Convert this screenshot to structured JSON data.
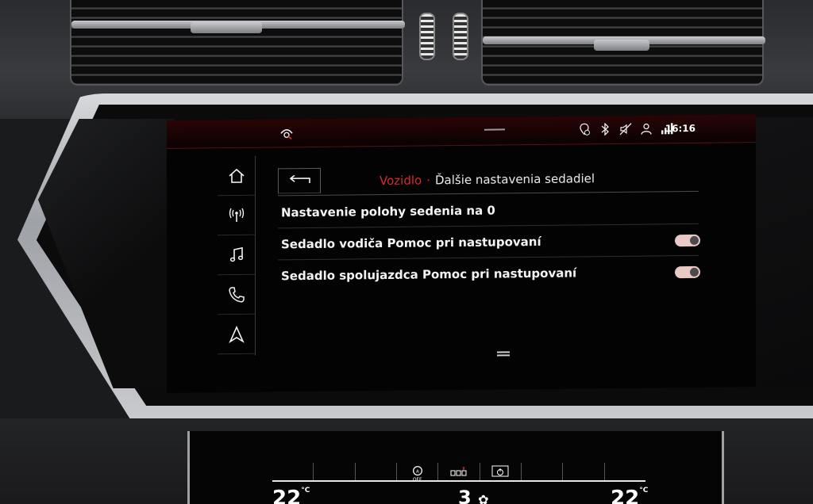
{
  "status_bar": {
    "time": "16:16",
    "icons": [
      "car-service-icon",
      "location-alert-icon",
      "bluetooth-icon",
      "mute-icon",
      "user-profile-icon",
      "signal-icon"
    ]
  },
  "nav": {
    "items": [
      {
        "name": "home-icon"
      },
      {
        "name": "radio-icon"
      },
      {
        "name": "music-icon"
      },
      {
        "name": "phone-icon"
      },
      {
        "name": "navigation-icon"
      }
    ]
  },
  "header": {
    "parent": "Vozidlo",
    "separator": "·",
    "title": "Ďalšie nastavenia sedadiel"
  },
  "settings": {
    "rows": [
      {
        "label": "Nastavenie polohy sedenia na 0",
        "has_toggle": false
      },
      {
        "label": "Sedadlo vodiča Pomoc pri nastupovaní",
        "has_toggle": true,
        "enabled": true
      },
      {
        "label": "Sedadlo spolujazdca Pomoc pri nastupovaní",
        "has_toggle": true,
        "enabled": true
      }
    ]
  },
  "climate": {
    "left_temp": "22",
    "right_temp": "22",
    "unit": "°C",
    "fan_level": "3",
    "auto_off_label": "OFF",
    "accent_color": "#e9c9c4"
  },
  "colors": {
    "accent_red": "#d72b2f",
    "toggle_on": "#e9c9c4",
    "background": "#030304"
  }
}
